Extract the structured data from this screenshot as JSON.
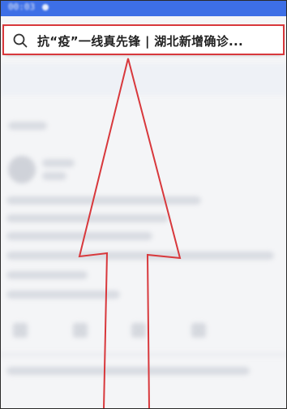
{
  "search": {
    "query_text": "抗“疫”一线真先锋 | 湖北新增确诊...",
    "icon": "search-icon"
  },
  "colors": {
    "highlight": "#d8383c",
    "status_bar": "#3d6fe6"
  }
}
